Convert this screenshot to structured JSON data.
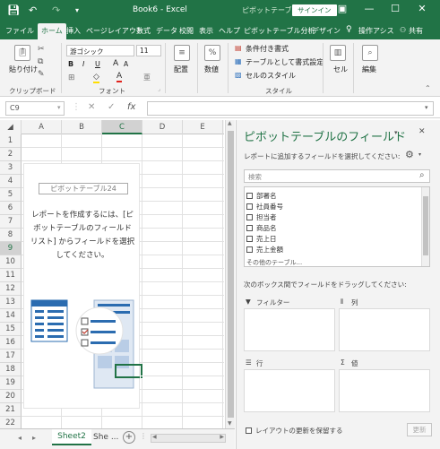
{
  "titlebar": {
    "title": "Book6 - Excel",
    "context_label": "ピボットテーブ...",
    "signin": "サインイン",
    "save_icon": "save-icon",
    "undo_icon": "undo-icon",
    "redo_icon": "redo-icon"
  },
  "tabs": [
    "ファイル",
    "ホーム",
    "挿入",
    "ページレイアウト",
    "数式",
    "データ",
    "校閲",
    "表示",
    "ヘルプ",
    "ピボットテーブル分析",
    "デザイン",
    "操作アシス",
    "共有"
  ],
  "ribbon": {
    "clipboard": {
      "paste": "貼り付け",
      "label": "クリップボード"
    },
    "font": {
      "name": "游ゴシック",
      "size": "11",
      "label": "フォント",
      "bold": "B",
      "italic": "I",
      "underline": "U"
    },
    "alignment": {
      "label": "配置"
    },
    "number": {
      "label": "数値",
      "symbol": "%"
    },
    "styles": {
      "conditional": "条件付き書式",
      "table": "テーブルとして書式設定",
      "cell_styles": "セルのスタイル",
      "label": "スタイル"
    },
    "cells": {
      "label": "セル"
    },
    "editing": {
      "label": "編集"
    }
  },
  "formula_bar": {
    "name_box": "C9",
    "cancel": "✕",
    "enter": "✓",
    "fx": "fx",
    "value": ""
  },
  "grid": {
    "columns": [
      "A",
      "B",
      "C",
      "D",
      "E"
    ],
    "selected_column": "C",
    "rows": [
      "1",
      "2",
      "3",
      "4",
      "5",
      "6",
      "7",
      "8",
      "9",
      "10",
      "11",
      "12",
      "13",
      "14",
      "15",
      "16",
      "17",
      "18",
      "19",
      "20",
      "21",
      "22"
    ],
    "selected_row": "9",
    "active_cell": "C9"
  },
  "pivot_placeholder": {
    "name": "ピボットテーブル24",
    "message_lines": [
      "レポートを作成するには、[ピ",
      "ボットテーブルのフィールド",
      "リスト] からフィールドを選択",
      "してください。"
    ]
  },
  "sheets": {
    "tabs": [
      "Sheet2",
      "She ..."
    ],
    "active": "Sheet2",
    "add": "+"
  },
  "field_pane": {
    "title": "ピボットテーブルのフィールド",
    "subtitle": "レポートに追加するフィールドを選択してください:",
    "search_placeholder": "検索",
    "fields": [
      "部署名",
      "社員番号",
      "担当者",
      "商品名",
      "売上日",
      "売上金額",
      "その他のテーブル..."
    ],
    "drag_hint": "次のボックス間でフィールドをドラッグしてください:",
    "areas": {
      "filter": "フィルター",
      "columns": "列",
      "rows": "行",
      "values": "値"
    },
    "defer_label": "レイアウトの更新を保留する",
    "update_button": "更新"
  },
  "colors": {
    "accent": "#217346",
    "ribbon_bg": "#f3f3f3",
    "pane_bg": "#f3f3f3"
  }
}
